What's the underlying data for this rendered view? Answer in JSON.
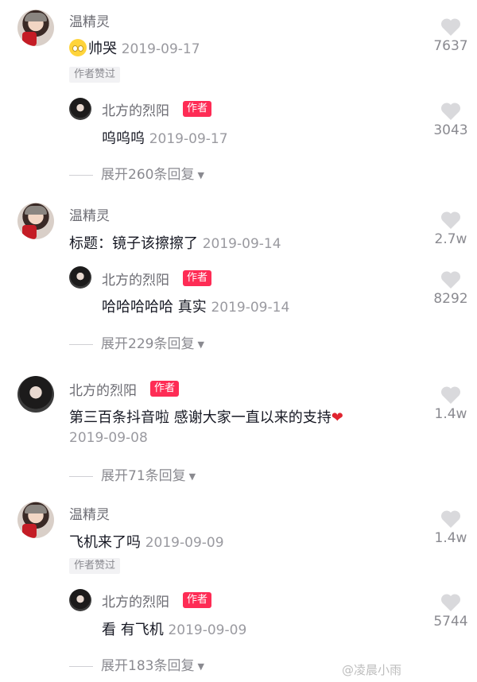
{
  "colors": {
    "author_tag": "#fe2c55",
    "like_icon": "#d9d9dc",
    "heart_emoji": "#e0242f"
  },
  "comments": [
    {
      "user": "温精灵",
      "text": "帅哭",
      "emoji": "crying-face-emoji",
      "date": "2019-09-17",
      "likes": "7637",
      "badge": "作者赞过",
      "reply": {
        "user": "北方的烈阳",
        "tag": "作者",
        "text": "呜呜呜",
        "date": "2019-09-17",
        "likes": "3043"
      },
      "expand": "展开260条回复"
    },
    {
      "user": "温精灵",
      "text": "标题：镜子该擦擦了",
      "date": "2019-09-14",
      "likes": "2.7w",
      "reply": {
        "user": "北方的烈阳",
        "tag": "作者",
        "text": "哈哈哈哈哈 真实",
        "date": "2019-09-14",
        "likes": "8292"
      },
      "expand": "展开229条回复"
    },
    {
      "user": "北方的烈阳",
      "tag": "作者",
      "text": "第三百条抖音啦 感谢大家一直以来的支持",
      "emoji_end": "❤",
      "date": "2019-09-08",
      "likes": "1.4w",
      "expand": "展开71条回复"
    },
    {
      "user": "温精灵",
      "text": "飞机来了吗",
      "date": "2019-09-09",
      "likes": "1.4w",
      "badge": "作者赞过",
      "reply": {
        "user": "北方的烈阳",
        "tag": "作者",
        "text": "看 有飞机",
        "date": "2019-09-09",
        "likes": "5744"
      },
      "expand": "展开183条回复"
    }
  ],
  "watermark": "@凌晨小雨"
}
